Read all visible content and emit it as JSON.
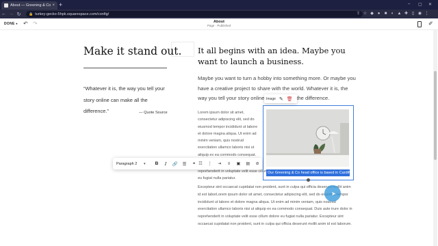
{
  "browser": {
    "tab_title": "About — Greening & Co",
    "tab_close": "×",
    "new_tab": "+",
    "url": "turkey-gecko-5hpk.squarespace.com/config/",
    "nav": {
      "back": "←",
      "forward": "→",
      "reload": "↻",
      "home": "⌂"
    },
    "window": {
      "min": "–",
      "max": "▢",
      "close": "✕"
    }
  },
  "editor": {
    "done_label": "DONE",
    "page_title": "About",
    "page_subtitle": "Page · Published"
  },
  "content": {
    "left_heading": "Make it stand out.",
    "quote": "“Whatever it is, the way you tell your story online can make all the difference.”",
    "quote_source": "— Quote Source",
    "right_heading": "It all begins with an idea. Maybe you want to launch a business.",
    "intro": "Maybe you want to turn a hobby into something more. Or maybe you have a creative project to share with the world. Whatever it is, the way you tell your story online can make all the difference.",
    "intro_tail": "all the difference.",
    "lorem_narrow": "Lorem ipsum dolor sit amet, consectetur adipiscing elit, sed do eiusmod tempor incididunt ut labore et dolore magna aliqua. Ut enim ad minim veniam, quis nostrud exercitation ullamco laboris nisi ut aliquip ex ea commodo consequat.",
    "lorem_narrow_end": "reprehenderit in voluptate velit esse cillum dolore eu fugiat nulla pariatur.",
    "lorem_wide": "Excepteur sint occaecat cupidatat non proident, sunt in culpa qui officia deserunt mollit anim id est laborLorem ipsum dolor sit amet, consectetur adipiscing elit, sed do eiusmod tempor incididunt ut labore et dolore magna aliqua. Ut enim ad minim veniam, quis nostrud exercitation ullamco laboris nisi ut aliquip ex ea commodo consequat. Duis aute irure dolor in reprehenderit in voluptate velit esse cillum dolore eu fugiat nulla pariatur. Excepteur sint occaecat cupidatat non proident, sunt in culpa qui officia deserunt mollit anim id est laborum."
  },
  "image_block": {
    "toolbar_label": "Image",
    "caption": "Our Greening & Co head office is based in Cardiff"
  },
  "format_toolbar": {
    "paragraph_style": "Paragraph 2",
    "bold": "B",
    "italic": "I"
  },
  "colors": {
    "selection": "#2f6fdc",
    "cursor": "#3498db",
    "delete": "#d23a3a",
    "chrome_dark": "#1d2040"
  }
}
